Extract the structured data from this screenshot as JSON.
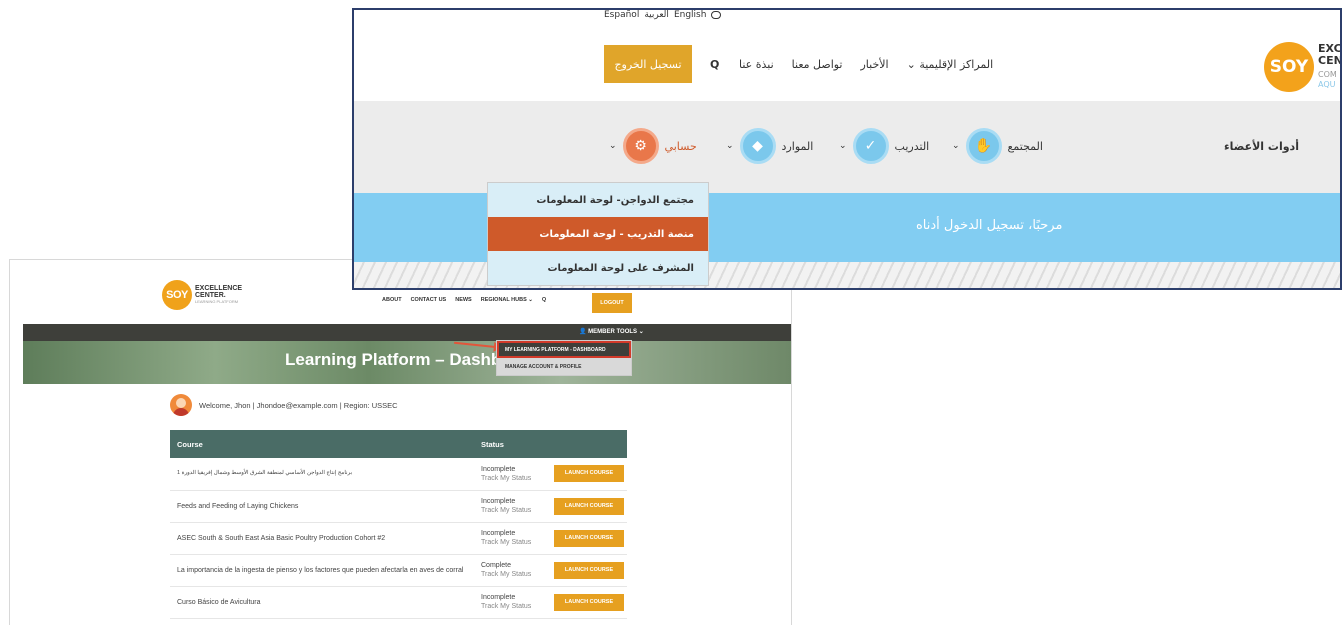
{
  "en": {
    "logo": {
      "badge": "SOY",
      "line1": "EXCELLENCE",
      "line2": "CENTER.",
      "line3": "LEARNING PLATFORM"
    },
    "nav": [
      "ABOUT",
      "CONTACT US",
      "NEWS",
      "REGIONAL HUBS ⌄",
      "Q"
    ],
    "logout": "LOGOUT",
    "member_tools": "👤 MEMBER TOOLS ⌄",
    "hero_title": "Learning Platform – Dashboard",
    "dropdown": [
      "MY LEARNING PLATFORM - DASHBOARD",
      "MANAGE ACCOUNT & PROFILE"
    ],
    "welcome": "Welcome, Jhon | Jhondoe@example.com | Region: USSEC",
    "table": {
      "headers": [
        "Course",
        "Status"
      ],
      "track": "Track My Status",
      "launch": "LAUNCH COURSE",
      "rows": [
        {
          "course": "برنامج إنتاج الدواجن الأساسي لمنطقة الشرق الأوسط وشمال إفريقيا الدورة 1",
          "status": "Incomplete"
        },
        {
          "course": "Feeds and Feeding of Laying Chickens",
          "status": "Incomplete"
        },
        {
          "course": "ASEC South & South East Asia Basic Poultry Production Cohort #2",
          "status": "Incomplete"
        },
        {
          "course": "La importancia de la ingesta de pienso y los factores que pueden afectarla en aves de corral",
          "status": "Complete"
        },
        {
          "course": "Curso Básico de Avicultura",
          "status": "Incomplete"
        }
      ]
    }
  },
  "ar": {
    "langs": [
      "Español",
      "العربية",
      "English"
    ],
    "logout": "تسجيل الخروج",
    "topnav": [
      "نبذة عنا",
      "تواصل معنا",
      "الأخبار",
      "المراكز الإقليمية ⌄"
    ],
    "logo": {
      "badge": "SOY",
      "line1": "EXC",
      "line2": "CEN",
      "line3": "COM",
      "line4": "AQU"
    },
    "member_tools": "أدوات الأعضاء",
    "menu": [
      "المجتمع",
      "التدريب",
      "الموارد",
      "حسابي"
    ],
    "welcome_banner": "مرحبًا، تسجيل الدخول أدناه",
    "dropdown": [
      "مجتمع الدواجن- لوحة المعلومات",
      "منصة التدريب - لوحة المعلومات",
      "المشرف على لوحة المعلومات"
    ]
  }
}
